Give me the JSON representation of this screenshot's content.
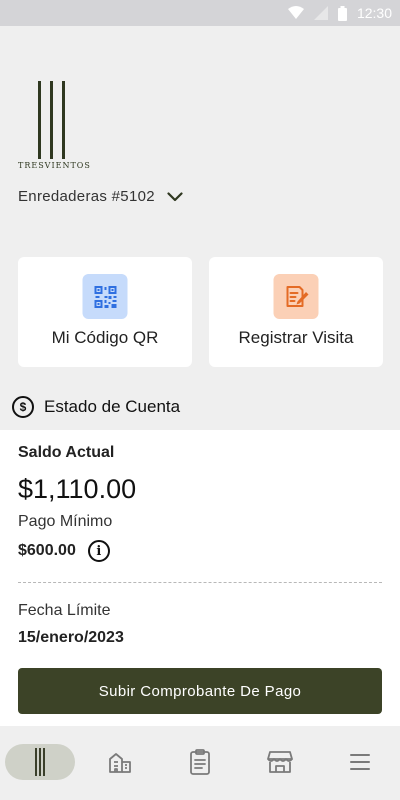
{
  "status_bar": {
    "time": "12:30"
  },
  "brand": {
    "name": "TRESVIENTOS"
  },
  "property": {
    "selected": "Enredaderas #5102"
  },
  "quick_actions": [
    {
      "label": "Mi Código QR",
      "icon": "qr-code-icon"
    },
    {
      "label": "Registrar Visita",
      "icon": "register-visit-icon"
    }
  ],
  "account": {
    "title": "Estado de Cuenta",
    "currency_symbol": "$",
    "saldo_label": "Saldo Actual",
    "saldo_value": "$1,110.00",
    "pago_label": "Pago Mínimo",
    "pago_value": "$600.00",
    "info_symbol": "i",
    "fecha_label": "Fecha Límite",
    "fecha_value": "15/enero/2023",
    "upload_button": "Subir Comprobante De Pago"
  },
  "bottom_nav": [
    "home-logo-icon",
    "building-icon",
    "clipboard-icon",
    "market-stall-icon",
    "menu-icon"
  ],
  "colors": {
    "primary": "#3c4327",
    "qr_tile": "#c6dbfb",
    "qr_icon": "#2f6fe0",
    "visit_tile": "#fbd0b6",
    "visit_icon": "#e46b25",
    "nav_active": "#cfd1c8"
  }
}
